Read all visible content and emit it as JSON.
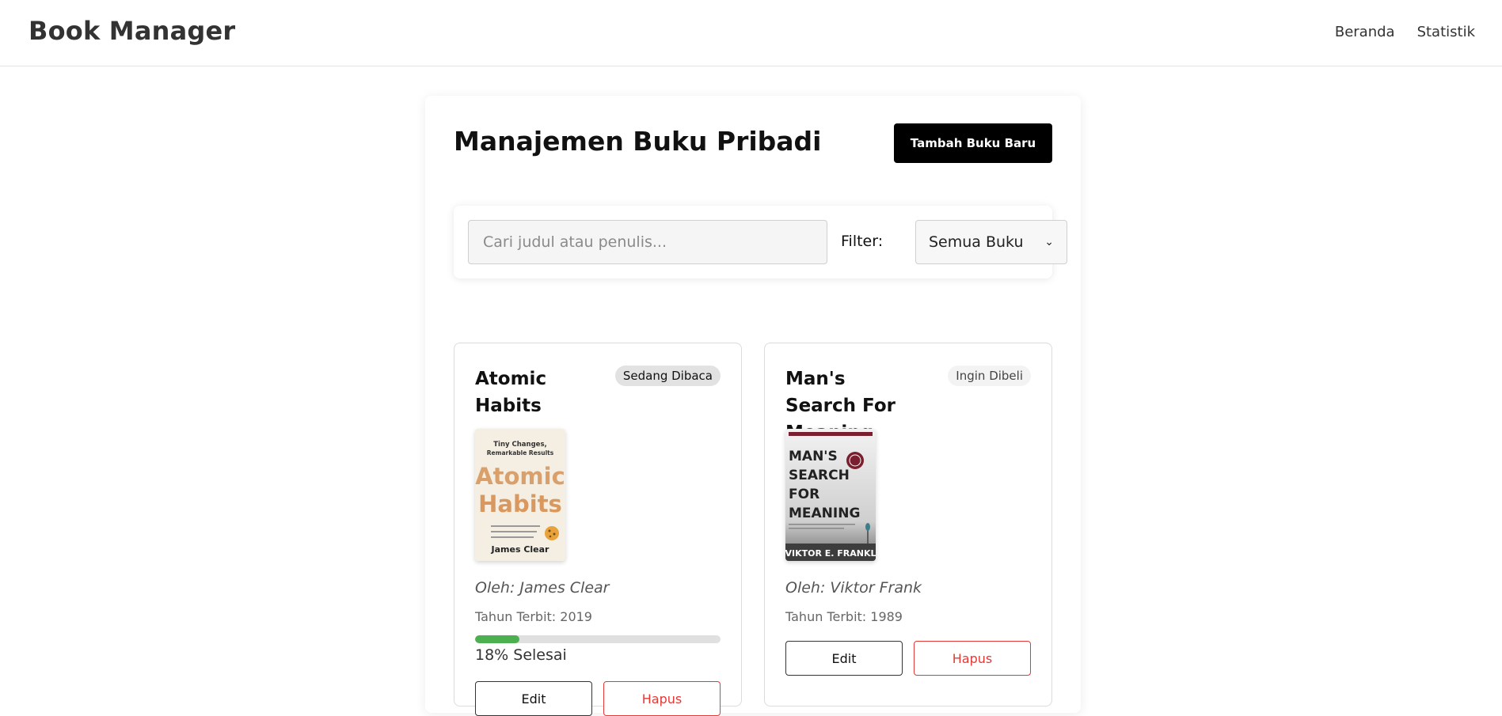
{
  "header": {
    "brand": "Book Manager",
    "nav": [
      "Beranda",
      "Statistik"
    ]
  },
  "main": {
    "title": "Manajemen Buku Pribadi",
    "add_button": "Tambah Buku Baru",
    "search": {
      "placeholder": "Cari judul atau penulis...",
      "value": ""
    },
    "filter": {
      "label": "Filter:",
      "selected": "Semua Buku"
    }
  },
  "books": [
    {
      "title": "Atomic Habits",
      "status": "Sedang Dibaca",
      "author": "Oleh: James Clear",
      "year": "Tahun Terbit: 2019",
      "progress_percent": 18,
      "progress_label": "18% Selesai",
      "edit_label": "Edit",
      "delete_label": "Hapus",
      "cover": {
        "tagline_1": "Tiny Changes,",
        "tagline_2": "Remarkable Results",
        "word_1": "Atomic",
        "word_2": "Habits",
        "author": "James Clear"
      }
    },
    {
      "title": "Man's Search For Meaning",
      "status": "Ingin Dibeli",
      "author": "Oleh: Viktor Frank",
      "year": "Tahun Terbit: 1989",
      "edit_label": "Edit",
      "delete_label": "Hapus",
      "cover": {
        "line_1": "MAN'S",
        "line_2": "SEARCH",
        "line_3": "FOR",
        "line_4": "MEANING",
        "author": "VIKTOR E. FRANKL"
      }
    }
  ],
  "colors": {
    "primary": "#000000",
    "progress": "#4caf50",
    "danger": "#e53935",
    "badge_reading": "#e2e2e2",
    "badge_wish": "#f3f3f3"
  }
}
